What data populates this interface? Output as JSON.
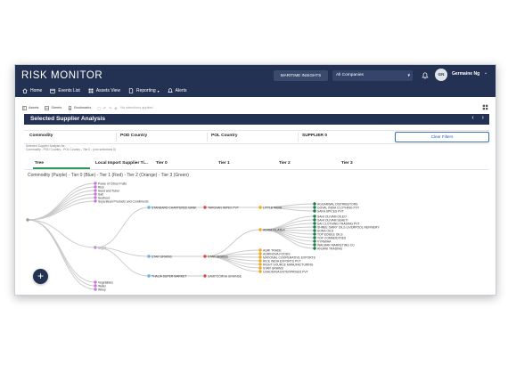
{
  "app": {
    "title": "RISK MONITOR"
  },
  "header": {
    "maritime_insights": "MARITIME INSIGHTS",
    "company_select": "All Companies",
    "avatar_initials": "GN",
    "user_name": "Germaine Ng"
  },
  "nav": {
    "items": [
      "Home",
      "Events List",
      "Assets View",
      "Reporting",
      "Alerts"
    ]
  },
  "toolbar": {
    "assets": "Assets",
    "sheets": "Sheets",
    "bookmarks": "Bookmarks",
    "selections": "No selections applied"
  },
  "section": {
    "title": "Selected Supplier Analysis"
  },
  "filters": {
    "cells": [
      "Commodity",
      "POD Country",
      "POL Country",
      "SUPPLIER 0"
    ],
    "clear": "Clear Filters"
  },
  "selection_caption": {
    "line1": "Selected Supplier Analysis for:",
    "line2": "Commodity - POD Country - POL Country - Tier 0 - (nos selections 0)"
  },
  "tabs": [
    "Tree",
    "Local Import Supplier Ti...",
    "Tier 0",
    "Tier 1",
    "Tier 2",
    "Tier 3"
  ],
  "legend_text": "Commodity (Purple) - Tier 0 (Blue) - Tier 1 (Red) - Tier 2 (Orange) - Tier 3 (Green)",
  "colors": {
    "header_bg": "#233253",
    "commodity": "#c47ad6",
    "tier0": "#5ab7e6",
    "tier1": "#d94a43",
    "tier2": "#f2a81f",
    "tier3": "#1f7a4a",
    "accent_green": "#2d9a59"
  },
  "tree": {
    "commodities_top": [
      "Purée of Citrus Fruits",
      "Rice",
      "Seed and Tuber",
      "Salt",
      "Seafood",
      "Soya Bean Products and Condiments"
    ],
    "commodity_mid": "Sugar",
    "commodities_bottom": [
      "Vegetables",
      "Water",
      "Whey"
    ],
    "tier0": [
      "STANDARD CHARTERED BANK",
      "STAR GRAINS",
      "THALIA SUPER MARKET"
    ],
    "tier1": [
      "TARGVAN IMPEX PVT",
      "STAR GRAINS",
      "SAMPOORNA GRAINSE"
    ],
    "tier2_top": [
      "LITTLE INDIA",
      "ADANI FILATEX"
    ],
    "tier2_list": [
      "AGRI TRADE",
      "AGRINOVA FOODS",
      "NATIONAL COOPERATIVE EXPORTS",
      "RICE INDIA EXPORTS PVT",
      "RIGHT SOURCE MANUFACTURING",
      "STAR GRAINS",
      "USHODAYA ENTERPRISES PVT"
    ],
    "tier3_a": [
      "AGGARWAL DISTRIBUTORS",
      "GOVAL INDIA CLOTHING PVT",
      "SAKA SPICES PVT"
    ],
    "tier3_b": [
      "SAHI OLIVAM OILEO",
      "SAHI OLIVAM SEAETI",
      "SAI CLOTHING TRADING PVT",
      "SHREE DAIRY OILS LIVERPOOL REFINERY",
      "SONA OILS",
      "TOP EDIBLE OILS",
      "TOP COMMODITIES",
      "VYRMIHA",
      "WALMAR MARKETING CU",
      "ANJANI TRADING"
    ]
  }
}
